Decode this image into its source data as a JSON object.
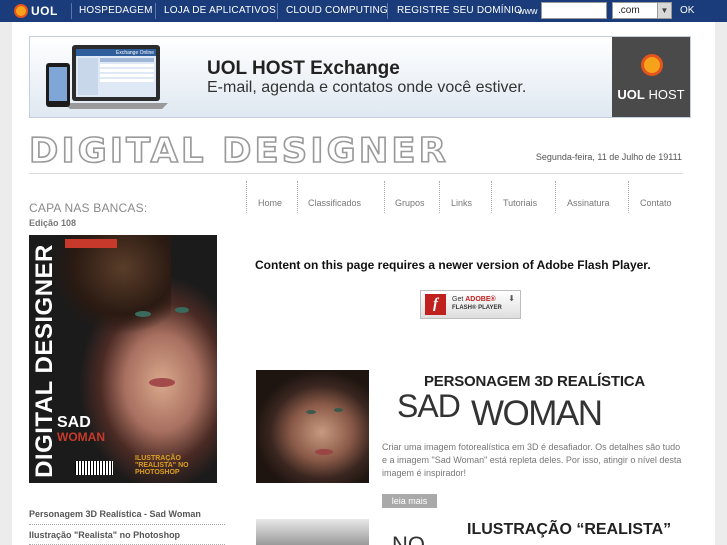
{
  "topbar": {
    "logo_text": "UOL",
    "nav": [
      "HOSPEDAGEM",
      "LOJA DE APLICATIVOS",
      "CLOUD COMPUTING",
      "REGISTRE SEU DOMÍNIO"
    ],
    "www_label": "www",
    "domain_value": "",
    "tld_selected": ".com",
    "ok_label": "OK",
    "bar_color": "#1a3c7a"
  },
  "ad": {
    "title": "UOL HOST Exchange",
    "subtitle": "E-mail, agenda e  contatos onde você estiver.",
    "screen_label": "Exchange Online",
    "brand_bold": "UOL",
    "brand_light": " HOST"
  },
  "header": {
    "logo_text": "DIGITAL DESIGNER",
    "date": "Segunda-feira, 11 de Julho de 19111"
  },
  "nav": {
    "items": [
      "Home",
      "Classificados",
      "Grupos",
      "Links",
      "Tutoriais",
      "Assinatura",
      "Contato"
    ]
  },
  "sidebar": {
    "heading": "CAPA NAS BANCAS:",
    "edition": "Edição 108",
    "cover_title": "DIGITAL DESIGNER",
    "cover_sad": "SAD",
    "cover_woman": "WOMAN",
    "cover_strap": "ILUSTRAÇÃO \"REALISTA\" NO PHOTOSHOP",
    "links": [
      "Personagem 3D Realística - Sad Woman",
      "Ilustração \"Realista\" no Photoshop"
    ]
  },
  "flash": {
    "message": "Content on this page requires a newer version of Adobe Flash Player.",
    "badge_get": "Get ",
    "badge_brand": "ADOBE®",
    "badge_product": "FLASH® PLAYER"
  },
  "featured": {
    "heading": "PERSONAGEM 3D REALÍSTICA",
    "big_sad": "SAD",
    "big_woman": "WOMAN",
    "description": "Criar uma imagem fotorealística em 3D é desafiador. Os detalhes são tudo e a imagem \"Sad Woman\" está repleta deles. Por isso, atingir o nível desta imagem é inspirador!",
    "read_more": "leia mais"
  },
  "second_article": {
    "heading": "ILUSTRAÇÃO “REALISTA”",
    "big_text": "NO"
  }
}
